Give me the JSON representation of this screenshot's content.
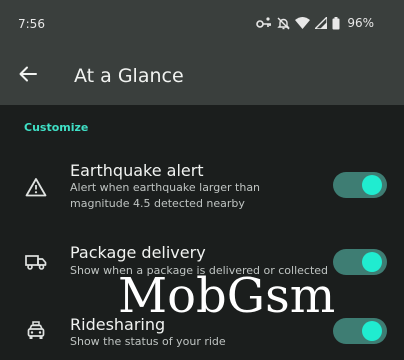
{
  "status_bar": {
    "time": "7:56",
    "battery_percent": "96%"
  },
  "app_bar": {
    "title": "At a Glance"
  },
  "section": {
    "header": "Customize"
  },
  "settings": [
    {
      "title": "Earthquake alert",
      "subtitle": "Alert when earthquake larger than magnitude 4.5 detected nearby",
      "icon": "warning-triangle-icon",
      "enabled": true
    },
    {
      "title": "Package delivery",
      "subtitle": "Show when a package is delivered or collected",
      "icon": "truck-icon",
      "enabled": true
    },
    {
      "title": "Ridesharing",
      "subtitle": "Show the status of your ride",
      "icon": "taxi-icon",
      "enabled": true
    }
  ],
  "watermark": "MobGsm",
  "colors": {
    "accent": "#3fe0c6",
    "switch_track": "#3e7d73",
    "switch_thumb": "#20ecd0",
    "background": "#1b1e1d",
    "app_bar": "#3a3f3d"
  }
}
